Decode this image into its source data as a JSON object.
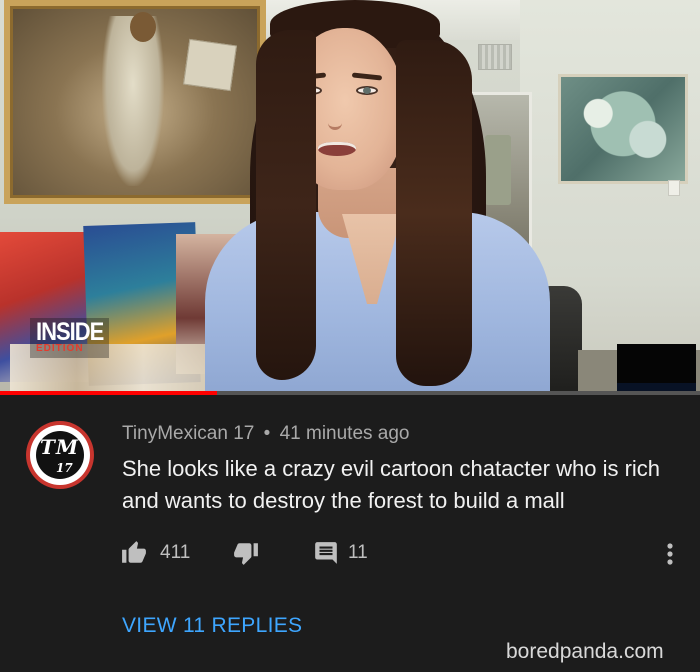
{
  "video": {
    "logo_main": "INSIDE",
    "logo_sub": "EDITION",
    "progress_fraction": 0.31
  },
  "comment": {
    "avatar_line1": "TM",
    "avatar_line2": "17",
    "author": "TinyMexican 17",
    "separator": "•",
    "time": "41 minutes ago",
    "text": "She looks like a crazy evil cartoon chatacter who is rich and wants to destroy the forest to build a mall",
    "likes": "411",
    "replies_count": "11",
    "view_replies_label": "VIEW 11 REPLIES"
  },
  "icons": {
    "like": "thumbs-up-icon",
    "dislike": "thumbs-down-icon",
    "reply": "comment-icon",
    "more": "more-vertical-icon"
  },
  "colors": {
    "background": "#1c1c1c",
    "link": "#3ea6ff",
    "progress": "#ff0000",
    "meta_text": "#a9a9a9"
  },
  "watermark": "boredpanda.com"
}
